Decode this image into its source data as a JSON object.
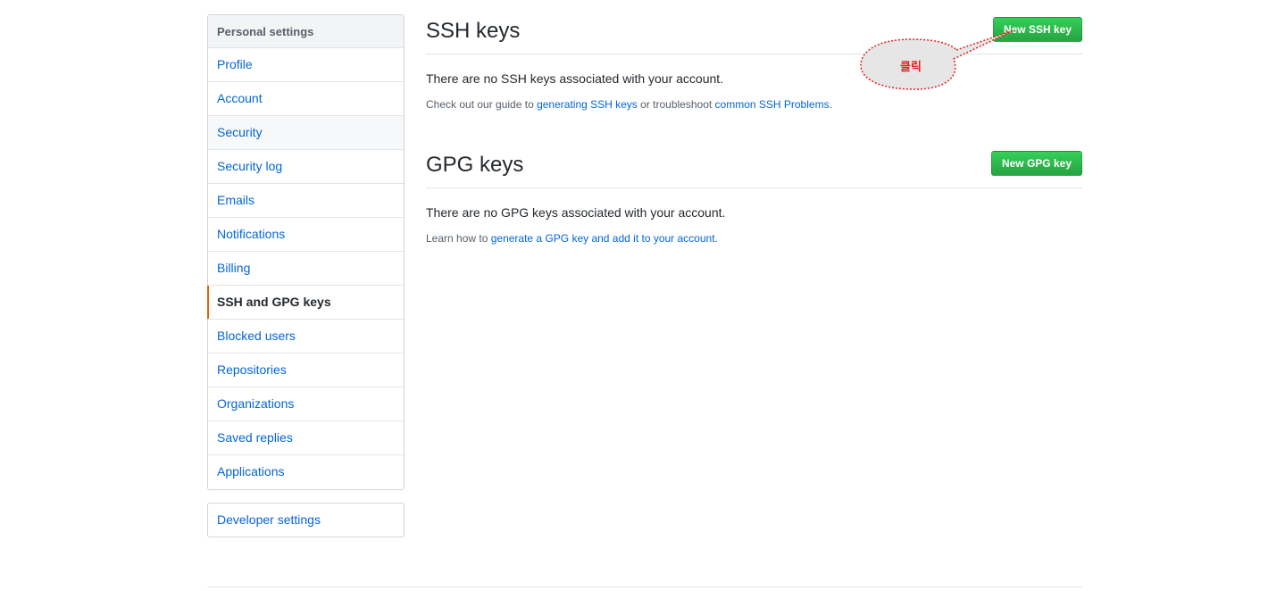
{
  "sidebar": {
    "heading": "Personal settings",
    "items": [
      {
        "label": "Profile"
      },
      {
        "label": "Account"
      },
      {
        "label": "Security"
      },
      {
        "label": "Security log"
      },
      {
        "label": "Emails"
      },
      {
        "label": "Notifications"
      },
      {
        "label": "Billing"
      },
      {
        "label": "SSH and GPG keys"
      },
      {
        "label": "Blocked users"
      },
      {
        "label": "Repositories"
      },
      {
        "label": "Organizations"
      },
      {
        "label": "Saved replies"
      },
      {
        "label": "Applications"
      }
    ],
    "developer_settings": "Developer settings",
    "selected_index": 7
  },
  "ssh": {
    "title": "SSH keys",
    "button": "New SSH key",
    "empty": "There are no SSH keys associated with your account.",
    "hint_prefix": "Check out our guide to ",
    "hint_link1": "generating SSH keys",
    "hint_middle": " or troubleshoot ",
    "hint_link2": "common SSH Problems",
    "hint_suffix": "."
  },
  "gpg": {
    "title": "GPG keys",
    "button": "New GPG key",
    "empty": "There are no GPG keys associated with your account.",
    "hint_prefix": "Learn how to ",
    "hint_link": "generate a GPG key and add it to your account",
    "hint_suffix": "."
  },
  "annotation": {
    "text": "클릭",
    "color": "#e02020"
  },
  "colors": {
    "link": "#0366d6",
    "button_green": "#28a745",
    "selected_marker": "#e36209"
  }
}
